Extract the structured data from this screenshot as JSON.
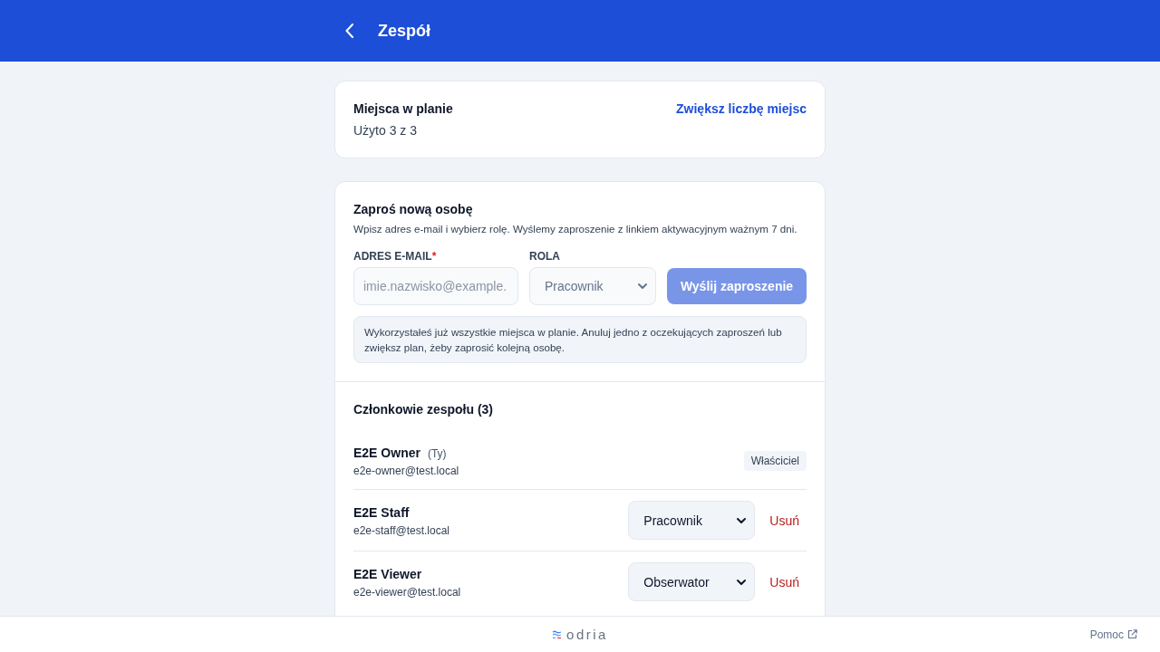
{
  "header": {
    "title": "Zespół"
  },
  "plan": {
    "title": "Miejsca w planie",
    "usage": "Użyto 3 z 3",
    "upgrade_link": "Zwiększ liczbę miejsc"
  },
  "invite": {
    "title": "Zaproś nową osobę",
    "description": "Wpisz adres e-mail i wybierz rolę. Wyślemy zaproszenie z linkiem aktywacyjnym ważnym 7 dni.",
    "email_field": {
      "label": "ADRES E-MAIL",
      "required_mark": "*",
      "placeholder": "imie.nazwisko@example.",
      "disabled": true
    },
    "role_field": {
      "label": "ROLA",
      "value": "Pracownik",
      "disabled": true
    },
    "submit_button": {
      "label": "Wyślij zaproszenie",
      "disabled": true
    },
    "notice": "Wykorzystałeś już wszystkie miejsca w planie. Anuluj jedno z oczekujących zaproszeń lub zwiększ plan, żeby zaprosić kolejną osobę."
  },
  "members": {
    "title": "Członkowie zespołu (3)",
    "items": [
      {
        "kind": "badge",
        "name": "E2E Owner",
        "you_label": "(Ty)",
        "email": "e2e-owner@test.local",
        "role": "Właściciel"
      },
      {
        "kind": "select",
        "name": "E2E Staff",
        "email": "e2e-staff@test.local",
        "role": "Pracownik",
        "remove": "Usuń"
      },
      {
        "kind": "select",
        "name": "E2E Viewer",
        "email": "e2e-viewer@test.local",
        "role": "Obserwator",
        "remove": "Usuń"
      }
    ]
  },
  "footer": {
    "logo_text": "odria",
    "help_link": "Pomoc"
  }
}
